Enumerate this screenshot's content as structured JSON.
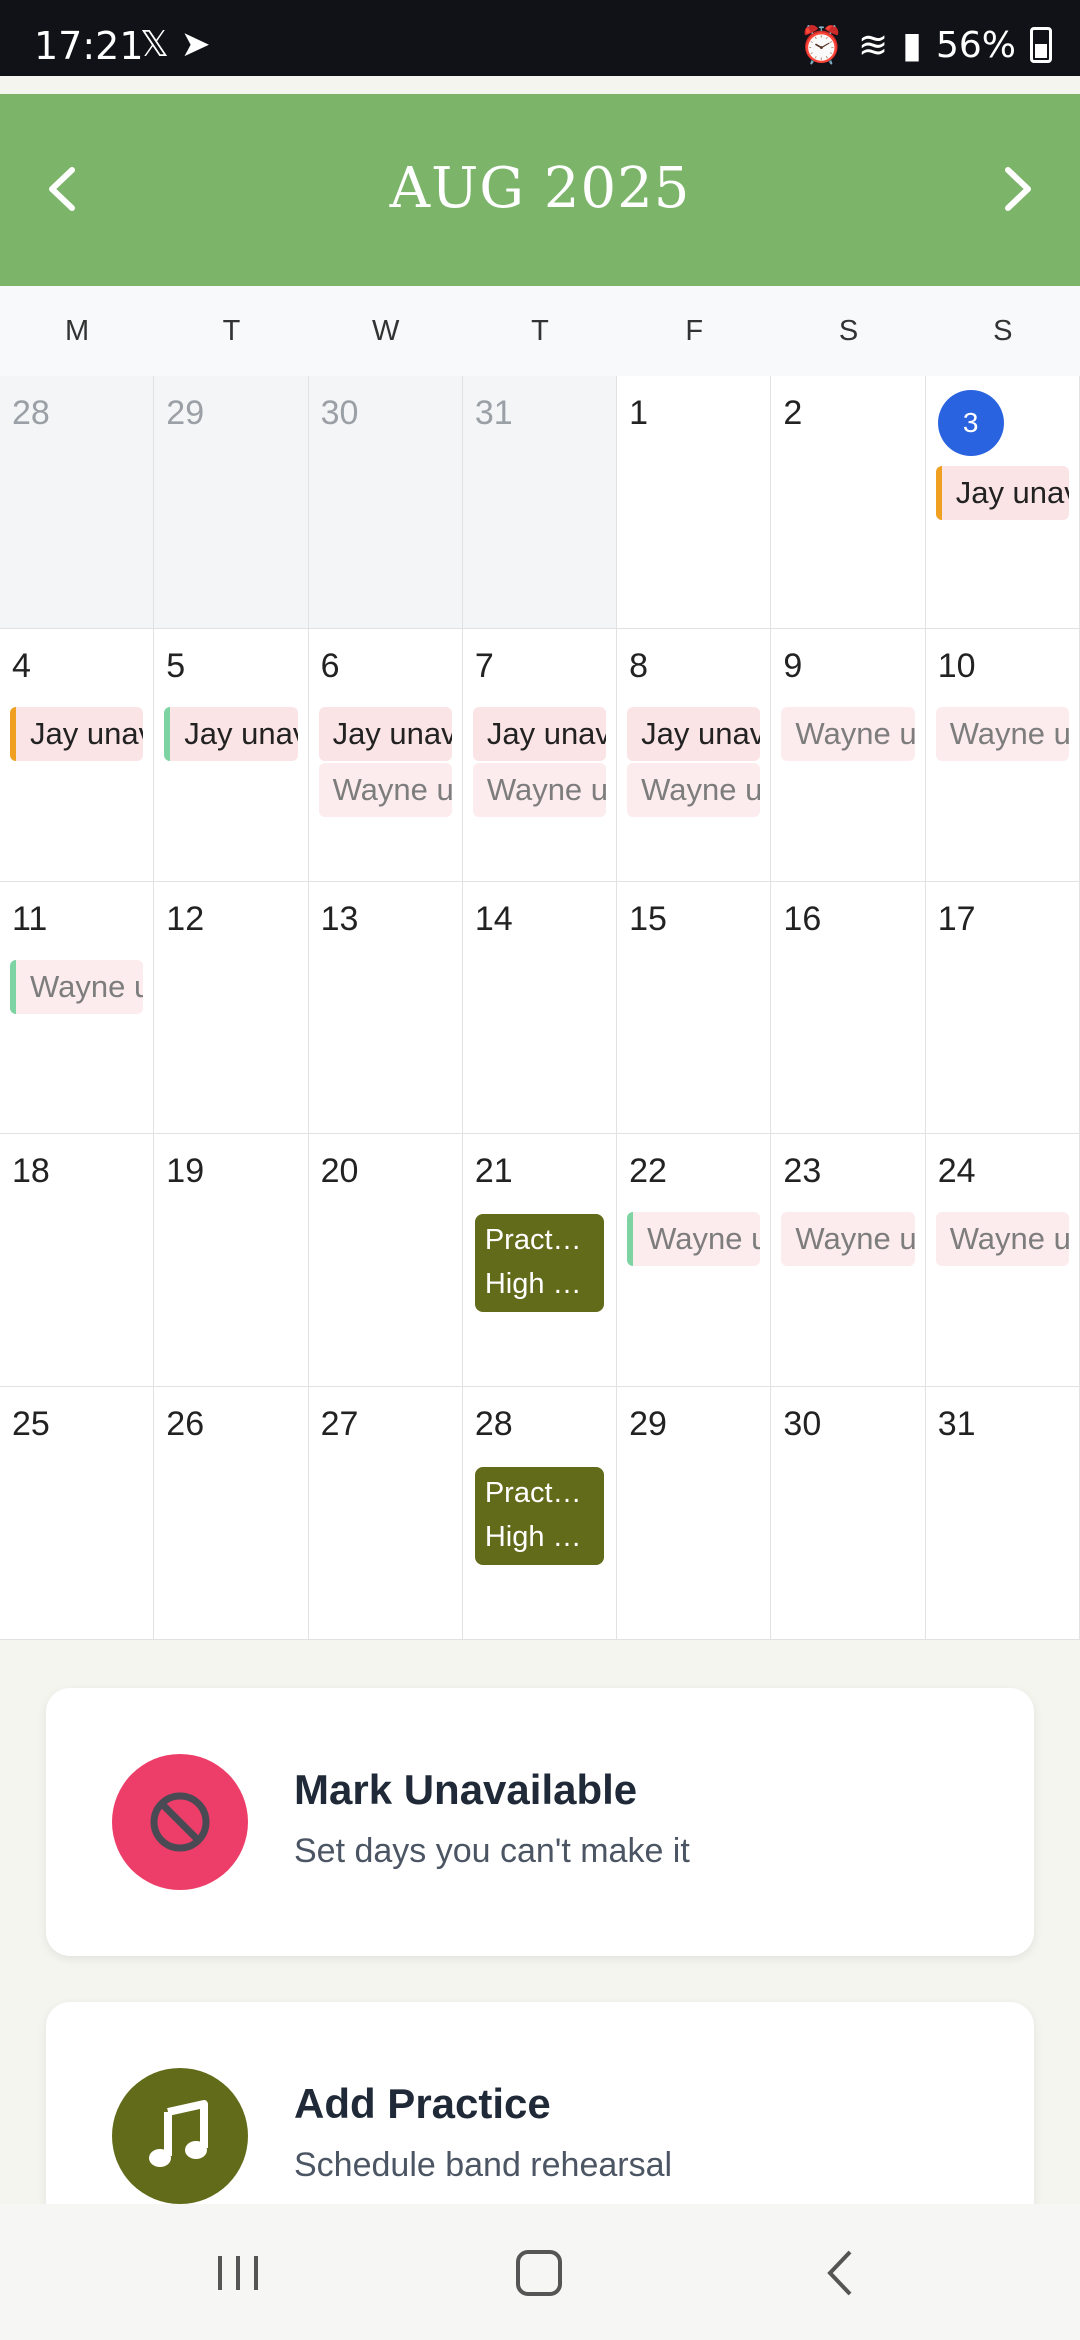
{
  "status": {
    "time": "17:21",
    "battery": "56%"
  },
  "calendar": {
    "month": "AUG 2025",
    "weekdays": [
      "M",
      "T",
      "W",
      "T",
      "F",
      "S",
      "S"
    ],
    "weeks": [
      [
        {
          "day": "28",
          "other": true
        },
        {
          "day": "29",
          "other": true
        },
        {
          "day": "30",
          "other": true
        },
        {
          "day": "31",
          "other": true
        },
        {
          "day": "1"
        },
        {
          "day": "2"
        },
        {
          "day": "3",
          "today": true,
          "events": [
            {
              "text": "Jay unav",
              "type": "jay",
              "border": "orange"
            }
          ]
        }
      ],
      [
        {
          "day": "4",
          "events": [
            {
              "text": "Jay unav",
              "type": "jay",
              "border": "orange"
            }
          ]
        },
        {
          "day": "5",
          "events": [
            {
              "text": "Jay unava",
              "type": "jay",
              "border": "green"
            }
          ]
        },
        {
          "day": "6",
          "events": [
            {
              "text": "Jay unava",
              "type": "jay"
            },
            {
              "text": "Wayne un",
              "type": "wayne"
            }
          ]
        },
        {
          "day": "7",
          "events": [
            {
              "text": "Jay unava",
              "type": "jay"
            },
            {
              "text": "Wayne un",
              "type": "wayne"
            }
          ]
        },
        {
          "day": "8",
          "events": [
            {
              "text": "Jay unava",
              "type": "jay"
            },
            {
              "text": "Wayne un",
              "type": "wayne"
            }
          ]
        },
        {
          "day": "9",
          "events": [
            {
              "text": "Wayne un",
              "type": "wayne"
            }
          ]
        },
        {
          "day": "10",
          "events": [
            {
              "text": "Wayne un",
              "type": "wayne"
            }
          ]
        }
      ],
      [
        {
          "day": "11",
          "events": [
            {
              "text": "Wayne u",
              "type": "wayne",
              "border": "green"
            }
          ]
        },
        {
          "day": "12"
        },
        {
          "day": "13"
        },
        {
          "day": "14"
        },
        {
          "day": "15"
        },
        {
          "day": "16"
        },
        {
          "day": "17"
        }
      ],
      [
        {
          "day": "18"
        },
        {
          "day": "19"
        },
        {
          "day": "20"
        },
        {
          "day": "21",
          "practice": [
            "Pract…",
            "High …"
          ]
        },
        {
          "day": "22",
          "events": [
            {
              "text": "Wayne u",
              "type": "wayne",
              "border": "green"
            }
          ]
        },
        {
          "day": "23",
          "events": [
            {
              "text": "Wayne un",
              "type": "wayne"
            }
          ]
        },
        {
          "day": "24",
          "events": [
            {
              "text": "Wayne un",
              "type": "wayne"
            }
          ]
        }
      ],
      [
        {
          "day": "25"
        },
        {
          "day": "26"
        },
        {
          "day": "27"
        },
        {
          "day": "28",
          "practice": [
            "Pract…",
            "High …"
          ]
        },
        {
          "day": "29"
        },
        {
          "day": "30"
        },
        {
          "day": "31"
        }
      ]
    ]
  },
  "actions": {
    "unavailable": {
      "title": "Mark Unavailable",
      "subtitle": "Set days you can't make it",
      "color": "#ec3e68",
      "icon": "block-icon"
    },
    "practice": {
      "title": "Add Practice",
      "subtitle": "Schedule band rehearsal",
      "color": "#626b19",
      "icon": "music-note-icon"
    }
  },
  "colors": {
    "header": "#7cb46a",
    "today": "#2a63e0",
    "practice": "#626b19"
  }
}
